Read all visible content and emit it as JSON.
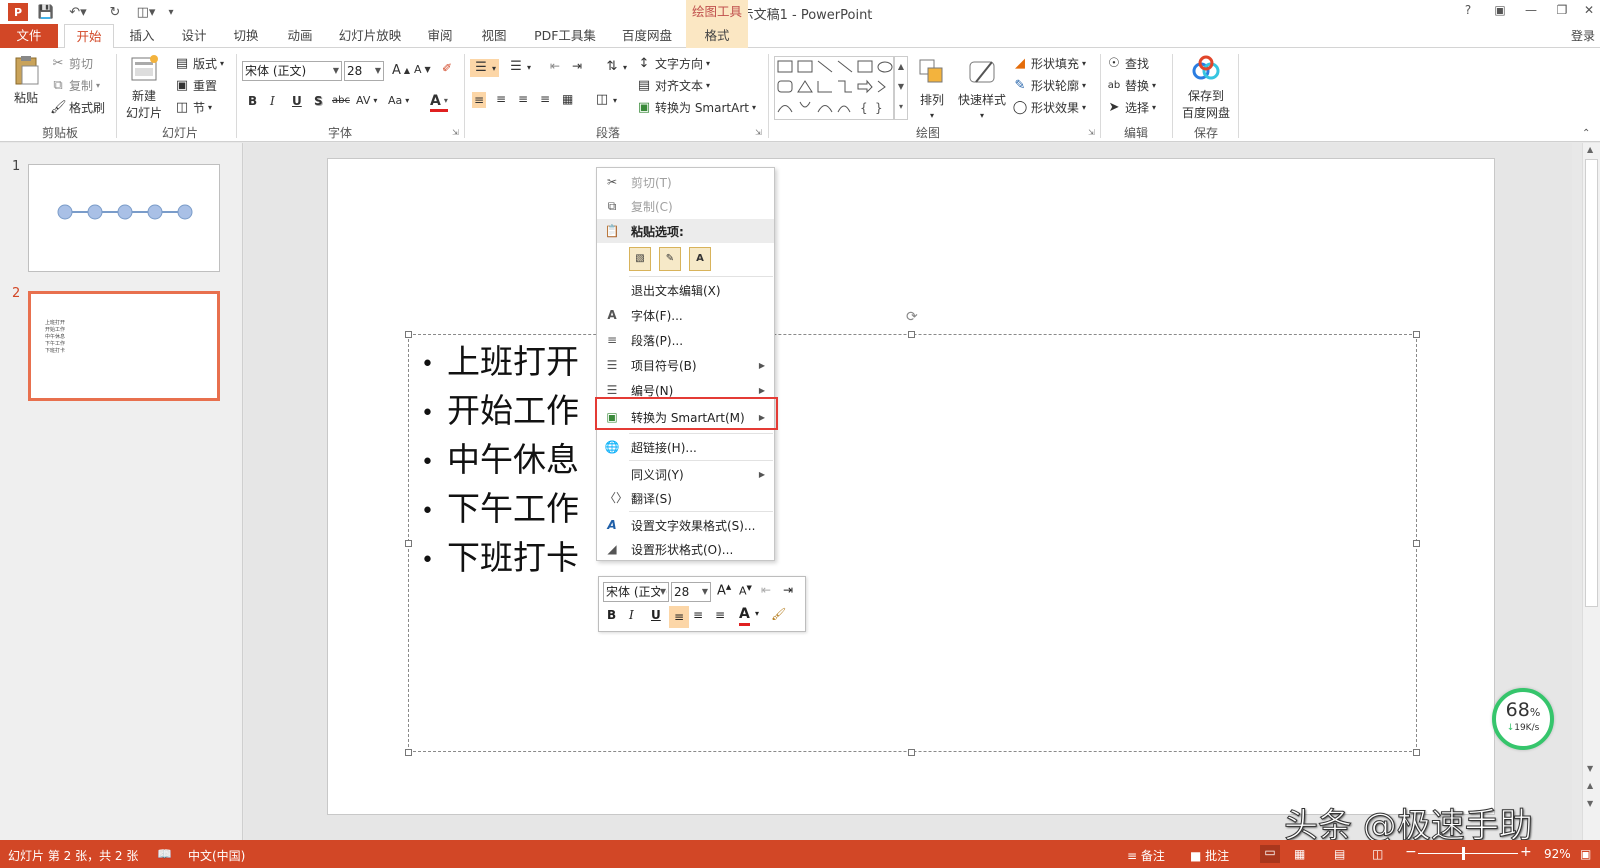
{
  "window": {
    "title": "演示文稿1 - PowerPoint",
    "help": "?",
    "login": "登录"
  },
  "tabs": [
    {
      "label": "文件"
    },
    {
      "label": "开始"
    },
    {
      "label": "插入"
    },
    {
      "label": "设计"
    },
    {
      "label": "切换"
    },
    {
      "label": "动画"
    },
    {
      "label": "幻灯片放映"
    },
    {
      "label": "审阅"
    },
    {
      "label": "视图"
    },
    {
      "label": "PDF工具集"
    },
    {
      "label": "百度网盘"
    },
    {
      "label": "格式"
    }
  ],
  "context_tab_header": "绘图工具",
  "ribbon": {
    "clipboard": {
      "paste": "粘贴",
      "cut": "剪切",
      "copy": "复制",
      "format_painter": "格式刷",
      "group": "剪贴板"
    },
    "slides": {
      "new_slide_1": "新建",
      "new_slide_2": "幻灯片",
      "layout": "版式",
      "reset": "重置",
      "section": "节",
      "group": "幻灯片"
    },
    "font": {
      "name": "宋体 (正文)",
      "size": "28",
      "group": "字体",
      "bold": "B",
      "italic": "I",
      "underline": "U",
      "shadow": "S",
      "strike": "abc",
      "spacing": "AV",
      "case": "Aa",
      "color": "A",
      "grow": "A",
      "shrink": "A"
    },
    "paragraph": {
      "text_direction": "文字方向",
      "align_text": "对齐文本",
      "convert_smartart": "转换为 SmartArt",
      "group": "段落"
    },
    "drawing": {
      "arrange": "排列",
      "quick_styles": "快速样式",
      "shape_fill": "形状填充",
      "shape_outline": "形状轮廓",
      "shape_effects": "形状效果",
      "group": "绘图"
    },
    "editing": {
      "find": "查找",
      "replace": "替换",
      "select": "选择",
      "group": "编辑"
    },
    "save": {
      "save_to_1": "保存到",
      "save_to_2": "百度网盘",
      "group": "保存"
    }
  },
  "thumbnails": [
    {
      "number": "1"
    },
    {
      "number": "2",
      "lines": [
        "上班打开",
        "开始工作",
        "中午休息",
        "下午工作",
        "下班打卡"
      ]
    }
  ],
  "slide_text": [
    "上班打开",
    "开始工作",
    "中午休息",
    "下午工作",
    "下班打卡"
  ],
  "context_menu": {
    "cut": "剪切(T)",
    "copy": "复制(C)",
    "paste_options": "粘贴选项:",
    "exit_edit": "退出文本编辑(X)",
    "font": "字体(F)...",
    "paragraph": "段落(P)...",
    "bullets": "项目符号(B)",
    "numbering": "编号(N)",
    "convert_smartart": "转换为 SmartArt(M)",
    "hyperlink": "超链接(H)...",
    "synonyms": "同义词(Y)",
    "translate": "翻译(S)",
    "text_effects": "设置文字效果格式(S)...",
    "shape_format": "设置形状格式(O)..."
  },
  "minibar": {
    "font": "宋体 (正文)",
    "size": "28",
    "bold": "B",
    "italic": "I",
    "underline": "U",
    "color": "A"
  },
  "status": {
    "slide_info": "幻灯片 第 2 张，共 2 张",
    "language": "中文(中国)",
    "notes": "备注",
    "comments": "批注",
    "zoom": "92%",
    "minus": "−",
    "plus": "+"
  },
  "net_badge": {
    "percent": "68",
    "unit": "%",
    "speed": "19K/s"
  },
  "watermark": "头条 @极速手助"
}
